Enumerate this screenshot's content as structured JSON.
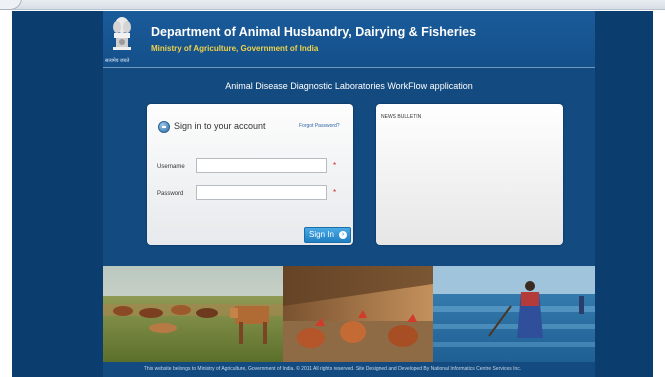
{
  "header": {
    "department_title": "Department of Animal Husbandry, Dairying & Fisheries",
    "ministry_subtitle": "Ministry of Agriculture, Government of India",
    "emblem_caption": "सत्यमेव जयते",
    "emblem_icon": "national-emblem-icon"
  },
  "app_title": "Animal Disease Diagnostic Laboratories WorkFlow application",
  "login": {
    "heading": "Sign in to your account",
    "forgot_password": "Forgot Password?",
    "username_label": "Username",
    "username_value": "",
    "password_label": "Password",
    "password_value": "",
    "required_marker": "*",
    "signin_label": "Sign In",
    "signin_icon": "arrow-right-circle-icon"
  },
  "news": {
    "title": "NEWS BULLETIN"
  },
  "footer": {
    "text": "This website belongs to Ministry of Agriculture, Government of India. © 2011 All rights reserved. Site Designed and Developed By National Informatics Centre Services Inc."
  },
  "colors": {
    "page_background": "#0b3d6e",
    "header_background": "#1a5b9a",
    "ministry_text": "#f0d24a",
    "signin_button": "#2f8fd2",
    "required_marker": "#d02020"
  }
}
